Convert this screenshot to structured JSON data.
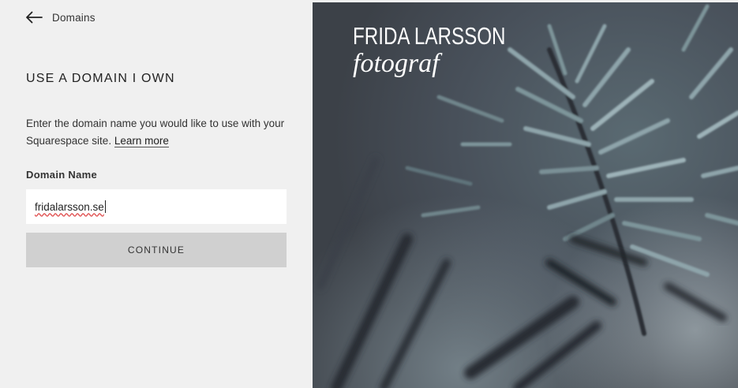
{
  "nav": {
    "back_label": "Domains",
    "back_icon": "arrow-left-icon"
  },
  "form": {
    "title": "USE A DOMAIN I OWN",
    "description": "Enter the domain name you would like to use with your Squarespace site.",
    "learn_more": "Learn more",
    "field_label": "Domain Name",
    "domain_value": "fridalarsson.se",
    "continue_label": "CONTINUE"
  },
  "preview": {
    "site_name": "FRIDA LARSSON",
    "site_tagline": "fotograf"
  },
  "colors": {
    "panel_bg": "#f0f0f0",
    "input_bg": "#ffffff",
    "button_bg": "#d0d0d0",
    "preview_bg": "#4a5058"
  }
}
